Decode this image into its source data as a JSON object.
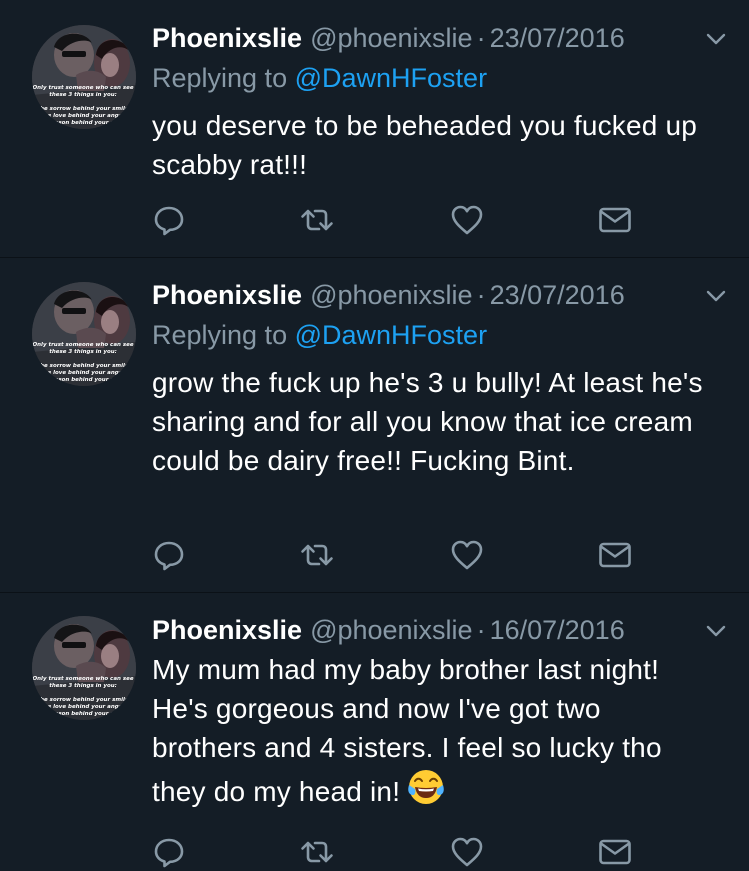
{
  "colors": {
    "background": "#141d26",
    "text": "#ffffff",
    "secondary": "#8899a6",
    "link": "#1da1f2",
    "divider": "#0b1117"
  },
  "avatar_caption": [
    "Only trust someone who can see",
    "these 3 things in you:",
    "the sorrow behind your smile",
    "the love behind your anger",
    "the reason behind your silence"
  ],
  "tweets": [
    {
      "name": "Phoenixslie",
      "handle": "@phoenixslie",
      "separator": "·",
      "date": "23/07/2016",
      "replying_label": "Replying to",
      "replying_to": "@DawnHFoster",
      "text": "you deserve to be beheaded you fucked up scabby rat!!!",
      "actions": [
        "reply-icon",
        "retweet-icon",
        "like-icon",
        "direct-message-icon"
      ]
    },
    {
      "name": "Phoenixslie",
      "handle": "@phoenixslie",
      "separator": "·",
      "date": "23/07/2016",
      "replying_label": "Replying to",
      "replying_to": "@DawnHFoster",
      "text": "grow the fuck up he's 3 u bully! At least he's sharing and for all you know that ice cream could be dairy free!! Fucking Bint.",
      "actions": [
        "reply-icon",
        "retweet-icon",
        "like-icon",
        "direct-message-icon"
      ]
    },
    {
      "name": "Phoenixslie",
      "handle": "@phoenixslie",
      "separator": "·",
      "date": "16/07/2016",
      "text": "My mum had my baby brother last night! He's gorgeous and now I've got two brothers and 4 sisters. I feel so lucky tho they do my head in!",
      "emoji": "face-with-tears-of-joy",
      "actions": [
        "reply-icon",
        "retweet-icon",
        "like-icon",
        "direct-message-icon"
      ]
    }
  ]
}
